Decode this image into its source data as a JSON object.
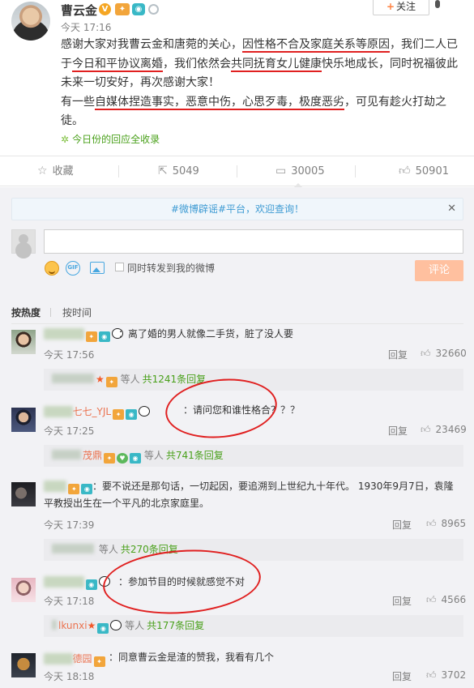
{
  "post": {
    "author": "曹云金",
    "time": "今天 17:16",
    "follow_label": "关注",
    "paragraphs": [
      [
        {
          "t": "感谢大家对我曹云金和唐菀的关心，",
          "u": false
        },
        {
          "t": "因性格不合及家庭关系等原因",
          "u": true
        },
        {
          "t": "，我们二人已于",
          "u": false
        },
        {
          "t": "今日和平协议离婚",
          "u": true
        },
        {
          "t": "，我们依然会",
          "u": false
        },
        {
          "t": "共同抚育女儿健康",
          "u": true
        },
        {
          "t": "快乐地成长，同时祝福彼此未来一切安好，再次感谢大家！",
          "u": false
        }
      ],
      [
        {
          "t": "有一些",
          "u": false
        },
        {
          "t": "自媒体捏造事实，恶意中伤，心思歹毒，极度恶劣",
          "u": true
        },
        {
          "t": "，可见有趁火打劫之徒。",
          "u": false
        }
      ]
    ],
    "collect_text": "今日份的回应全收录"
  },
  "actions": {
    "favorite": "收藏",
    "repost": "5049",
    "comment": "30005",
    "like": "50901"
  },
  "comment_box": {
    "notice": "#微博辟谣#平台，欢迎查询！",
    "notice_close": "✕",
    "repost_checkbox_label": "同时转发到我的微博",
    "submit_label": "评论",
    "gif_label": "GIF"
  },
  "sort": {
    "hot": "按热度",
    "time": "按时间"
  },
  "comments": [
    {
      "name_tail": "",
      "text": "：离了婚的男人就像二手货，脏了没人要",
      "time": "今天 17:56",
      "reply": "回复",
      "likes": "32660",
      "sub": {
        "prefix": "",
        "count_text": "等人",
        "total": "共1241条回复"
      }
    },
    {
      "name_tail": "七七_YJL",
      "text": "：请问您和谁性格合？？？",
      "time": "今天 17:25",
      "reply": "回复",
      "likes": "23469",
      "sub": {
        "prefix": "茂鼎",
        "count_text": "等人",
        "total": "共741条回复"
      }
    },
    {
      "name_tail": "",
      "text": "：要不说还是那句话，一切起因，要追溯到上世纪九十年代。  1930年9月7日，袁隆平教授出生在一个平凡的北京家庭里。",
      "time": "今天 17:39",
      "reply": "回复",
      "likes": "8965",
      "sub": {
        "prefix": "",
        "count_text": "等人",
        "total": "共270条回复"
      }
    },
    {
      "name_tail": "",
      "text": "：参加节目的时候就感觉不对",
      "time": "今天 17:18",
      "reply": "回复",
      "likes": "4566",
      "sub": {
        "prefix": "lkunxi",
        "count_text": "等人",
        "total": "共177条回复"
      }
    },
    {
      "name_tail": "德园",
      "text": "：同意曹云金是渣的赞我，我看有几个",
      "time": "今天 18:18",
      "reply": "回复",
      "likes": "3702"
    }
  ],
  "colors": {
    "accent": "#eb7350",
    "underline": "#e02020",
    "green": "#49a01a",
    "notice": "#3e9bd3"
  },
  "icons": [
    "star-icon",
    "repost-icon",
    "comment-icon",
    "thumbs-up-icon",
    "emoji-icon",
    "gif-icon",
    "image-icon",
    "close-icon",
    "leaf-icon"
  ]
}
